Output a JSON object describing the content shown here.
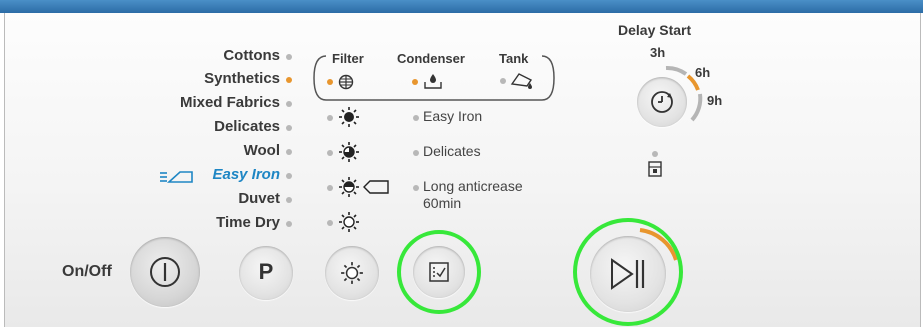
{
  "programs": [
    {
      "label": "Cottons",
      "active": false
    },
    {
      "label": "Synthetics",
      "active": true
    },
    {
      "label": "Mixed Fabrics",
      "active": false
    },
    {
      "label": "Delicates",
      "active": false
    },
    {
      "label": "Wool",
      "active": false
    },
    {
      "label": "Easy Iron",
      "active": false
    },
    {
      "label": "Duvet",
      "active": false
    },
    {
      "label": "Time Dry",
      "active": false
    }
  ],
  "indicators": {
    "filter_label": "Filter",
    "condenser_label": "Condenser",
    "tank_label": "Tank",
    "filter_active": true,
    "condenser_active": true
  },
  "options": {
    "easy_iron": "Easy Iron",
    "delicates": "Delicates",
    "long_anticrease_1": "Long anticrease",
    "long_anticrease_2": "60min"
  },
  "delay_start": {
    "title": "Delay Start",
    "h3": "3h",
    "h6": "6h",
    "h9": "9h"
  },
  "buttons": {
    "on_off_label": "On/Off",
    "program_symbol": "P"
  },
  "colors": {
    "accent": "#1e86c4",
    "indicator_on": "#e8962e",
    "highlight": "#37e83a",
    "header_bar": "#2c6ca6"
  }
}
